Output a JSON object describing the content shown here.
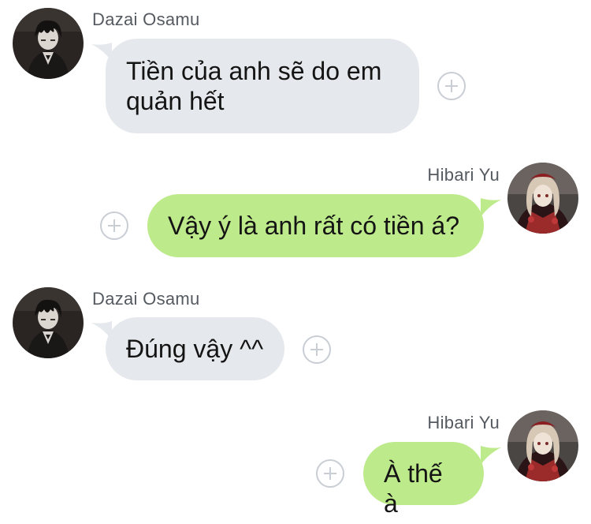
{
  "colors": {
    "incoming_bubble": "#e5e8ec",
    "outgoing_bubble": "#bdea8b",
    "name_text": "#555a60",
    "plus_icon": "#c9ced4"
  },
  "messages": [
    {
      "direction": "incoming",
      "sender": "Dazai Osamu",
      "avatar_icon": "dazai-avatar",
      "lines": [
        "Tiền của anh sẽ do em",
        "quản hết"
      ]
    },
    {
      "direction": "outgoing",
      "sender": "Hibari Yu",
      "avatar_icon": "hibari-avatar",
      "lines": [
        "Vậy ý là anh rất có tiền á?"
      ]
    },
    {
      "direction": "incoming",
      "sender": "Dazai Osamu",
      "avatar_icon": "dazai-avatar",
      "lines": [
        "Đúng vậy ^^"
      ]
    },
    {
      "direction": "outgoing",
      "sender": "Hibari Yu",
      "avatar_icon": "hibari-avatar",
      "lines": [
        "À thế à"
      ]
    }
  ],
  "reaction_button_icon": "plus-circle-icon"
}
